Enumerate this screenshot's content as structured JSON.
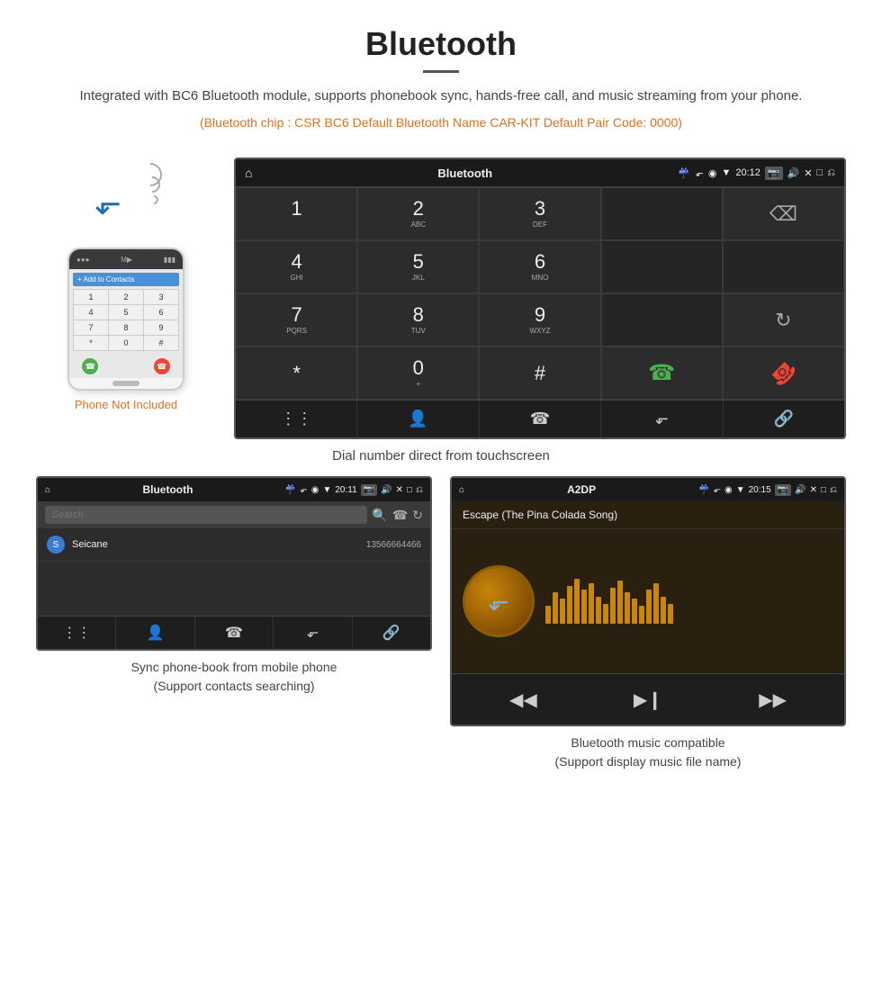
{
  "page": {
    "title": "Bluetooth",
    "divider": true,
    "description": "Integrated with BC6 Bluetooth module, supports phonebook sync, hands-free call, and music streaming from your phone.",
    "bt_info": "(Bluetooth chip : CSR BC6    Default Bluetooth Name CAR-KIT    Default Pair Code: 0000)"
  },
  "phone_illustration": {
    "not_included_label": "Phone Not Included",
    "keypad_keys": [
      "1",
      "2",
      "3",
      "4",
      "5",
      "6",
      "7",
      "8",
      "9",
      "*",
      "0",
      "#"
    ]
  },
  "car_screen_dialpad": {
    "status_bar": {
      "title": "Bluetooth",
      "time": "20:12"
    },
    "keys": [
      {
        "num": "1",
        "sub": ""
      },
      {
        "num": "2",
        "sub": "ABC"
      },
      {
        "num": "3",
        "sub": "DEF"
      },
      {
        "num": "",
        "sub": ""
      },
      {
        "num": "⌫",
        "sub": ""
      },
      {
        "num": "4",
        "sub": "GHI"
      },
      {
        "num": "5",
        "sub": "JKL"
      },
      {
        "num": "6",
        "sub": "MNO"
      },
      {
        "num": "",
        "sub": ""
      },
      {
        "num": "",
        "sub": ""
      },
      {
        "num": "7",
        "sub": "PQRS"
      },
      {
        "num": "8",
        "sub": "TUV"
      },
      {
        "num": "9",
        "sub": "WXYZ"
      },
      {
        "num": "",
        "sub": ""
      },
      {
        "num": "↺",
        "sub": ""
      },
      {
        "num": "*",
        "sub": ""
      },
      {
        "num": "0",
        "sub": "+"
      },
      {
        "num": "#",
        "sub": ""
      },
      {
        "num": "📞",
        "sub": "green"
      },
      {
        "num": "📵",
        "sub": "red"
      }
    ],
    "toolbar_icons": [
      "⋮⋮⋮",
      "👤",
      "📞",
      "✱",
      "🔗"
    ],
    "dial_caption": "Dial number direct from touchscreen"
  },
  "contacts_screen": {
    "status_bar_title": "Bluetooth",
    "time": "20:11",
    "search_placeholder": "Search",
    "contacts": [
      {
        "letter": "S",
        "name": "Seicane",
        "number": "13566664466"
      }
    ],
    "toolbar_icons": [
      "⋮⋮⋮",
      "👤",
      "📞",
      "✱",
      "🔗"
    ],
    "caption_line1": "Sync phone-book from mobile phone",
    "caption_line2": "(Support contacts searching)"
  },
  "music_screen": {
    "status_bar_title": "A2DP",
    "time": "20:15",
    "song_title": "Escape (The Pina Colada Song)",
    "eq_bars": [
      20,
      35,
      28,
      42,
      50,
      38,
      45,
      30,
      22,
      40,
      48,
      35,
      28,
      20,
      38,
      45,
      30,
      22
    ],
    "controls": [
      "⏮",
      "⏯",
      "⏭"
    ],
    "caption_line1": "Bluetooth music compatible",
    "caption_line2": "(Support display music file name)"
  },
  "colors": {
    "orange": "#e07020",
    "blue": "#1a6bb5",
    "green": "#4caf50",
    "red": "#f44336",
    "dark_bg": "#2a2a2a",
    "darker_bg": "#1a1a1a"
  }
}
